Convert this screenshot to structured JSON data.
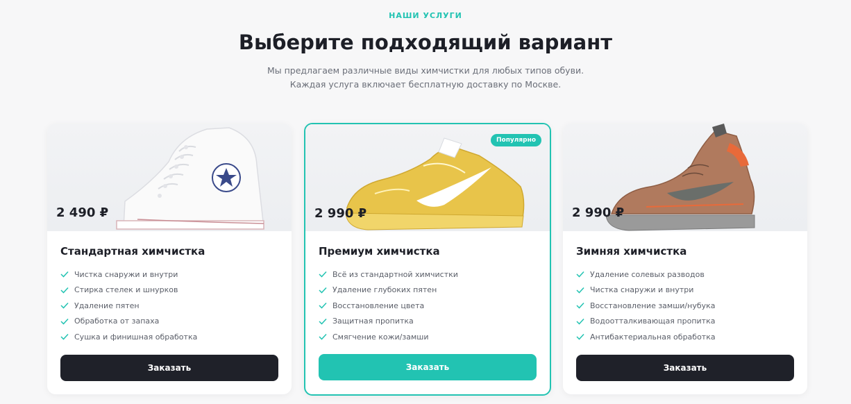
{
  "header": {
    "eyebrow": "НАШИ УСЛУГИ",
    "title": "Выберите подходящий вариант",
    "subtitle": "Мы предлагаем различные виды химчистки для любых типов обуви. Каждая услуга включает бесплатную доставку по Москве."
  },
  "cards": [
    {
      "price": "2 490 ₽",
      "title": "Стандартная химчистка",
      "features": [
        "Чистка снаружи и внутри",
        "Стирка стелек и шнурков",
        "Удаление пятен",
        "Обработка от запаха",
        "Сушка и финишная обработка"
      ],
      "button": "Заказать",
      "image_icon": "white-high-top-sneaker"
    },
    {
      "price": "2 990 ₽",
      "badge": "Популярно",
      "title": "Премиум химчистка",
      "features": [
        "Всё из стандартной химчистки",
        "Удаление глубоких пятен",
        "Восстановление цвета",
        "Защитная пропитка",
        "Смягчение кожи/замши"
      ],
      "button": "Заказать",
      "image_icon": "yellow-low-top-sneaker"
    },
    {
      "price": "2 990 ₽",
      "title": "Зимняя химчистка",
      "features": [
        "Удаление солевых разводов",
        "Чистка снаружи и внутри",
        "Восстановление замши/нубука",
        "Водоотталкивающая пропитка",
        "Антибактериальная обработка"
      ],
      "button": "Заказать",
      "image_icon": "brown-winter-sneaker"
    }
  ],
  "colors": {
    "accent": "#22c3b2",
    "dark": "#1f2129",
    "background": "#f7f7f8"
  }
}
